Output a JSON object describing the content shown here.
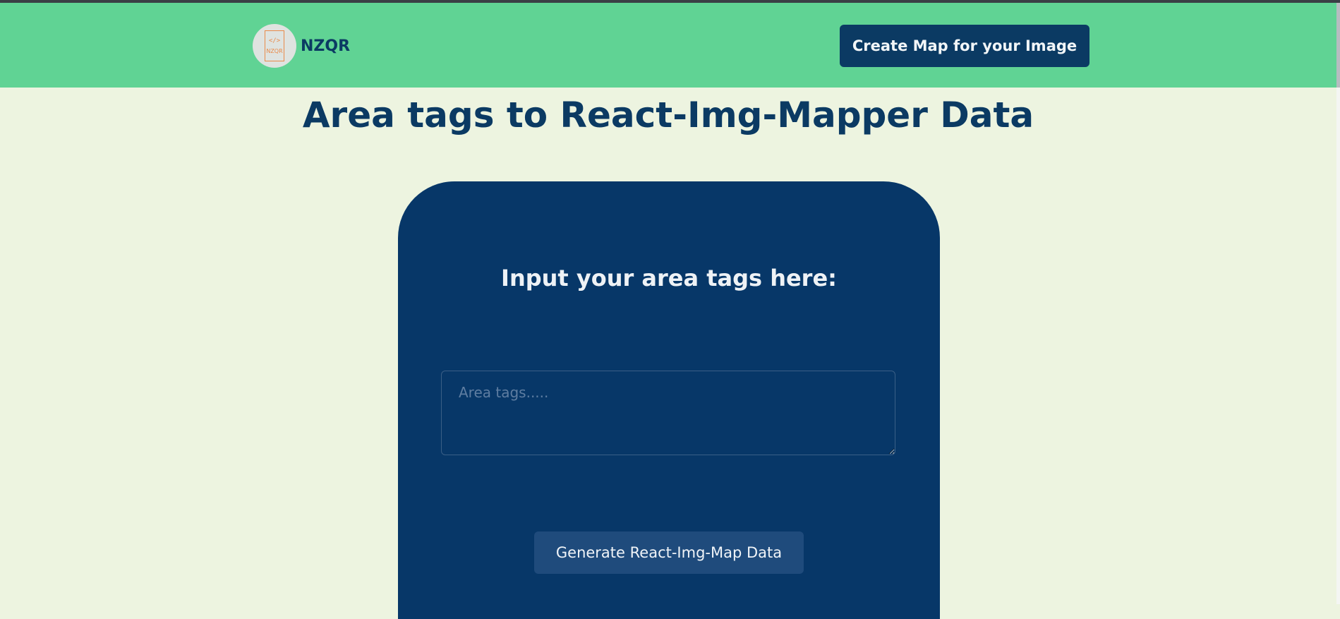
{
  "header": {
    "brand": {
      "logo_code": "</>",
      "logo_text": "NZQR",
      "name": "NZQR"
    },
    "cta_label": "Create Map for your Image"
  },
  "main": {
    "title": "Area tags to React-Img-Mapper Data",
    "card": {
      "heading": "Input your area tags here:",
      "input": {
        "value": "",
        "placeholder": "Area tags....."
      },
      "button_label": "Generate React-Img-Map Data"
    }
  },
  "colors": {
    "navbar": "#60d394",
    "page_background": "#edf4e0",
    "primary": "#0b3a63",
    "card": "#073768",
    "card_button": "#1f4b7c",
    "logo_accent": "#e98a4a"
  },
  "icons": {
    "logo": "code-file-icon",
    "resize": "resize-handle-icon"
  }
}
